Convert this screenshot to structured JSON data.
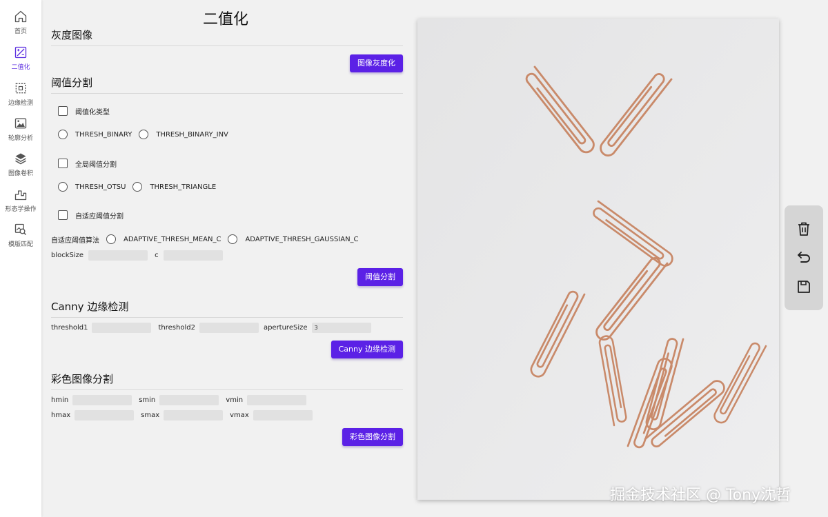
{
  "sidebar": {
    "items": [
      {
        "label": "首页",
        "icon": "home-icon"
      },
      {
        "label": "二值化",
        "icon": "binarize-icon"
      },
      {
        "label": "边缘检测",
        "icon": "edge-detect-icon"
      },
      {
        "label": "轮廓分析",
        "icon": "contour-icon"
      },
      {
        "label": "图像卷积",
        "icon": "layers-icon"
      },
      {
        "label": "形态学操作",
        "icon": "morphology-icon"
      },
      {
        "label": "模版匹配",
        "icon": "template-match-icon"
      }
    ],
    "active_index": 1,
    "accent_color": "#5b2ee0"
  },
  "page": {
    "title": "二值化"
  },
  "grayscale": {
    "title": "灰度图像",
    "button": "图像灰度化"
  },
  "threshold": {
    "title": "阈值分割",
    "type_checkbox": "阈值化类型",
    "binary": "THRESH_BINARY",
    "binary_inv": "THRESH_BINARY_INV",
    "global_checkbox": "全局阈值分割",
    "otsu": "THRESH_OTSU",
    "triangle": "THRESH_TRIANGLE",
    "adaptive_checkbox": "自适应阈值分割",
    "algo_label": "自适应阈值算法",
    "mean_c": "ADAPTIVE_THRESH_MEAN_C",
    "gaussian_c": "ADAPTIVE_THRESH_GAUSSIAN_C",
    "block_size_label": "blockSize",
    "block_size_value": "",
    "c_label": "c",
    "c_value": "",
    "button": "阈值分割"
  },
  "canny": {
    "title": "Canny 边缘检测",
    "threshold1_label": "threshold1",
    "threshold1_value": "",
    "threshold2_label": "threshold2",
    "threshold2_value": "",
    "aperture_label": "apertureSize",
    "aperture_value": "3",
    "button": "Canny 边缘检测"
  },
  "color_seg": {
    "title": "彩色图像分割",
    "hmin": "hmin",
    "smin": "smin",
    "vmin": "vmin",
    "hmax": "hmax",
    "smax": "smax",
    "vmax": "vmax",
    "button": "彩色图像分割"
  },
  "toolbox": {
    "icons": [
      "trash-icon",
      "undo-icon",
      "save-icon"
    ]
  },
  "watermark": "掘金技术社区 @ Tony沈哲",
  "colors": {
    "button": "#5b21e6",
    "paperclip": "#c98a6a"
  }
}
